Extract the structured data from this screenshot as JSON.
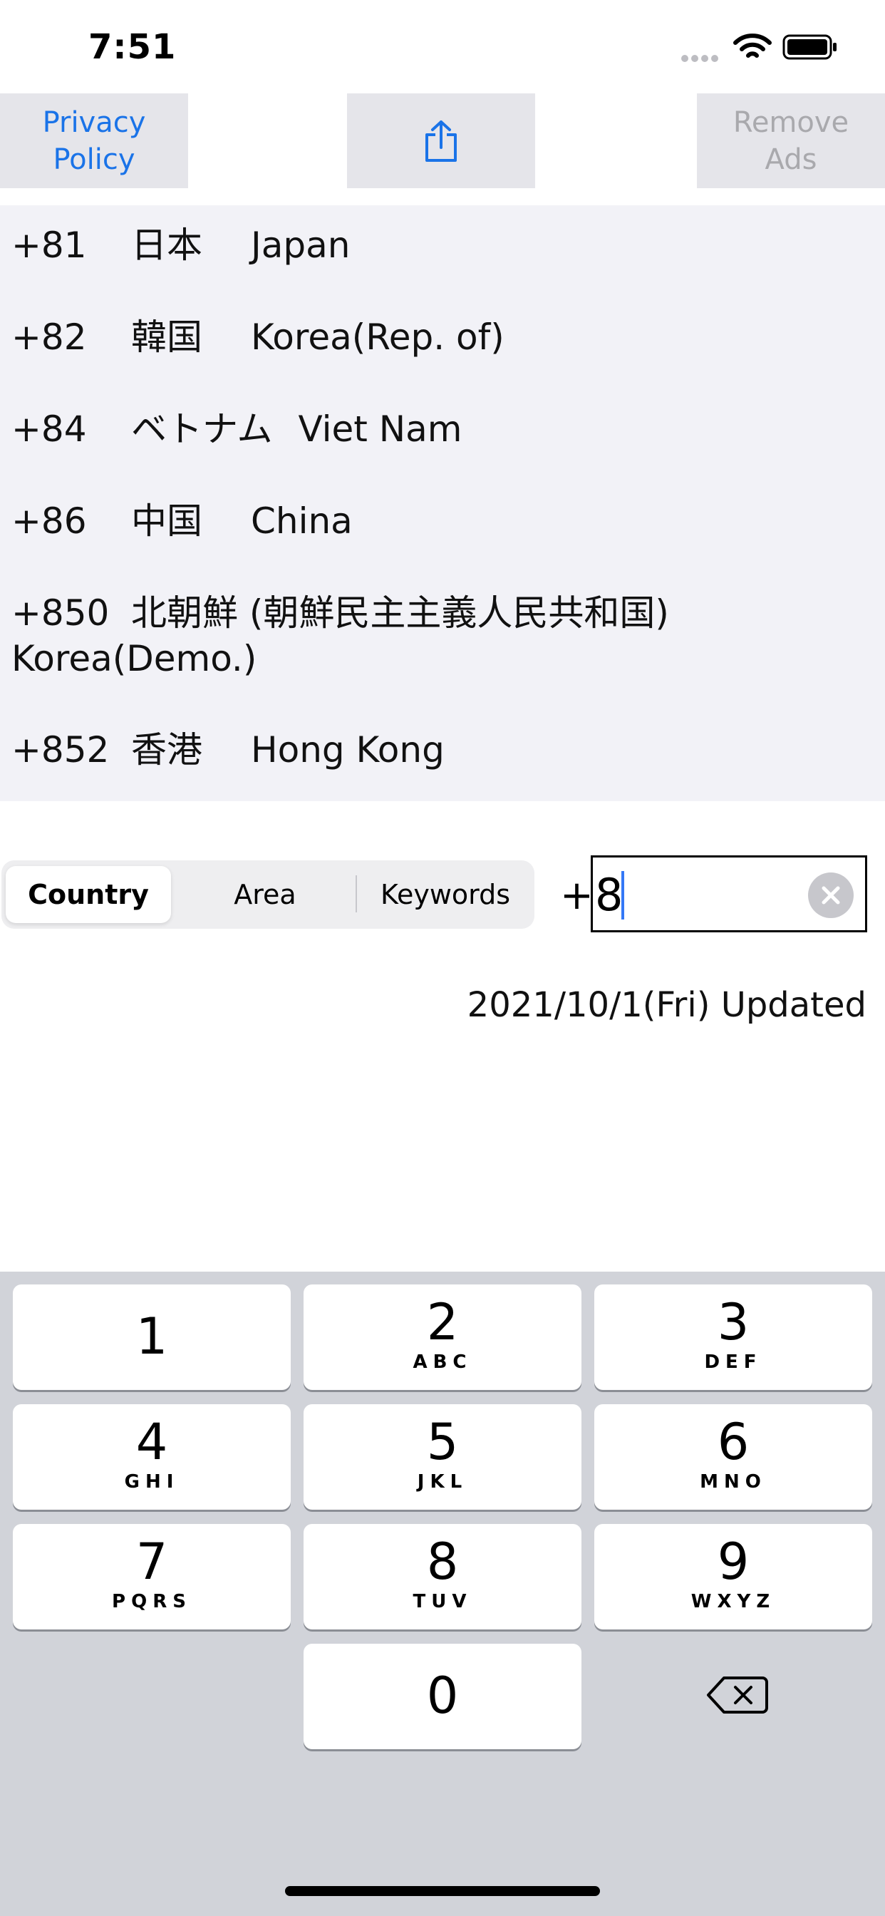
{
  "status": {
    "time": "7:51"
  },
  "top_buttons": {
    "privacy_line1": "Privacy",
    "privacy_line2": "Policy",
    "remove_line1": "Remove",
    "remove_line2": "Ads"
  },
  "list": [
    {
      "code": "+81",
      "native": "日本",
      "english": "Japan"
    },
    {
      "code": "+82",
      "native": "韓国",
      "english": "Korea(Rep. of)"
    },
    {
      "code": "+84",
      "native": "ベトナム",
      "english": "Viet Nam"
    },
    {
      "code": "+86",
      "native": "中国",
      "english": "China"
    },
    {
      "code": "+850",
      "native": "北朝鮮 (朝鮮民主主義人民共和国)",
      "english": "Korea(Demo.)"
    },
    {
      "code": "+852",
      "native": "香港",
      "english": "Hong Kong"
    }
  ],
  "segments": [
    "Country",
    "Area",
    "Keywords"
  ],
  "input": {
    "prefix": "+",
    "value": "8"
  },
  "updated": "2021/10/1(Fri) Updated",
  "keypad": [
    {
      "num": "1",
      "letters": ""
    },
    {
      "num": "2",
      "letters": "ABC"
    },
    {
      "num": "3",
      "letters": "DEF"
    },
    {
      "num": "4",
      "letters": "GHI"
    },
    {
      "num": "5",
      "letters": "JKL"
    },
    {
      "num": "6",
      "letters": "MNO"
    },
    {
      "num": "7",
      "letters": "PQRS"
    },
    {
      "num": "8",
      "letters": "TUV"
    },
    {
      "num": "9",
      "letters": "WXYZ"
    },
    {
      "num": "0",
      "letters": ""
    }
  ],
  "colors": {
    "accent": "#1a73e8",
    "list_bg": "#f2f2f7",
    "button_bg": "#e5e5ea",
    "keypad_bg": "#d1d3d9"
  }
}
